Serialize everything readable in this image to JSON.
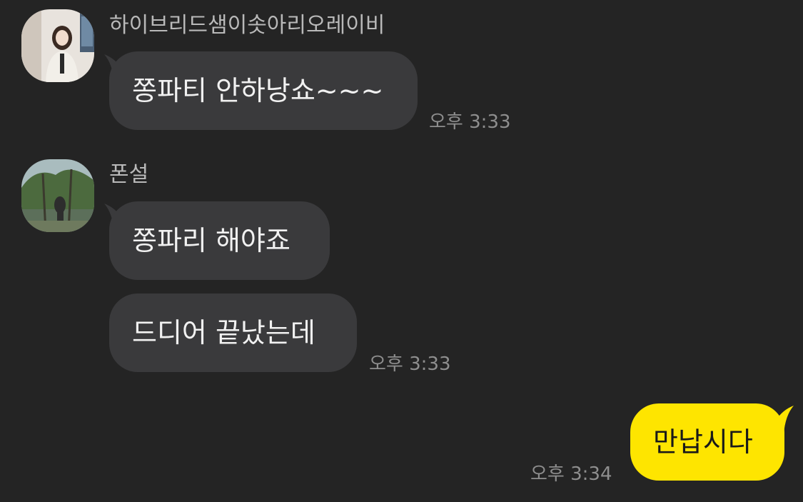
{
  "messages": [
    {
      "sender": "하이브리드샘이솟아리오레이비",
      "text": "쫑파티 안하낭쇼~~~",
      "time": "오후 3:33"
    },
    {
      "sender": "폰설",
      "text1": "쫑파리 해야죠",
      "text2": "드디어 끝났는데",
      "time": "오후 3:33"
    },
    {
      "text": "만납시다",
      "time": "오후 3:34"
    }
  ],
  "colors": {
    "background": "#242424",
    "incoming_bubble": "#3a3a3c",
    "outgoing_bubble": "#fee500"
  }
}
